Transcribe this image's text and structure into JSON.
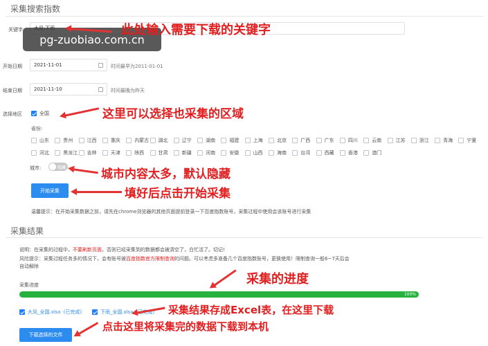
{
  "collect_search": {
    "section_title": "采集搜索指数",
    "keyword": {
      "label": "关键字",
      "value": "大风,下雨"
    },
    "start_date": {
      "label": "开始日期",
      "value": "2021-11-01",
      "hint": "时间最早为2011-01-01"
    },
    "end_date": {
      "label": "结束日期",
      "value": "2021-11-10",
      "hint": "时间最晚为昨天"
    },
    "region": {
      "label": "选择地区",
      "national_label": "全国",
      "national_checked": true,
      "province_label": "省份:",
      "provinces_row1": [
        "山东",
        "贵州",
        "江西",
        "重庆",
        "内蒙古",
        "湖北",
        "辽宁",
        "湖南",
        "福建",
        "上海",
        "北京",
        "广西",
        "广东",
        "四川",
        "云南",
        "江苏",
        "浙江",
        "青海",
        "宁夏"
      ],
      "provinces_row2": [
        "河北",
        "黑龙江",
        "吉林",
        "天津",
        "陕西",
        "甘肃",
        "新疆",
        "河南",
        "安徽",
        "山西",
        "海南",
        "台湾",
        "西藏",
        "香港",
        "澳门"
      ],
      "city_label": "城市:",
      "city_toggle_text": "隐藏",
      "city_toggle_on": false
    },
    "start_button": "开始采集",
    "tip": "温馨提示：在开始采集数据之前，请先在chrome浏览器的其他页面提前登录一下百度指数账号，采集过程中使用会该账号进行采集"
  },
  "collect_result": {
    "section_title": "采集结果",
    "note1_prefix": "说明：在采集的过程中，",
    "note1_warn": "不要刷新页面",
    "note1_suffix": "，否则已经采集到的数据都会被清空了，白忙活了。切记!",
    "note2_prefix": "风险提示：采集过程任务多的情况下，会有账号被",
    "note2_warn": "百度指数官方限制查询",
    "note2_suffix": "的问题。可以考虑多准备几个百度指数账号，更换使用！限制查询一般6~7天后会",
    "note2_line2": "自动解除",
    "progress_label": "采集进度",
    "progress_percent": 100,
    "progress_text": "100%",
    "files": [
      {
        "name": "大风_全国.xlsx",
        "status": "(已完成)",
        "checked": true
      },
      {
        "name": "下雨_全国.xlsx",
        "status": "(已完成)",
        "checked": true
      }
    ],
    "download_button": "下载选择的文件"
  },
  "annotations": {
    "keyword_note": "此处输入需要下载的关键字",
    "region_note": "这里可以选择也采集的区域",
    "city_note": "城市内容太多，默认隐藏",
    "start_note": "填好后点击开始采集",
    "progress_note": "采集的进度",
    "excel_note": "采集结果存成Excel表，在这里下载",
    "download_note": "点击这里将采集完的数据下载到本机"
  },
  "watermark": "pg-zuobiao.com.cn",
  "colors": {
    "annotation_red": "#e02020",
    "primary_blue": "#2d8cf0",
    "progress_green": "#27b13f"
  }
}
